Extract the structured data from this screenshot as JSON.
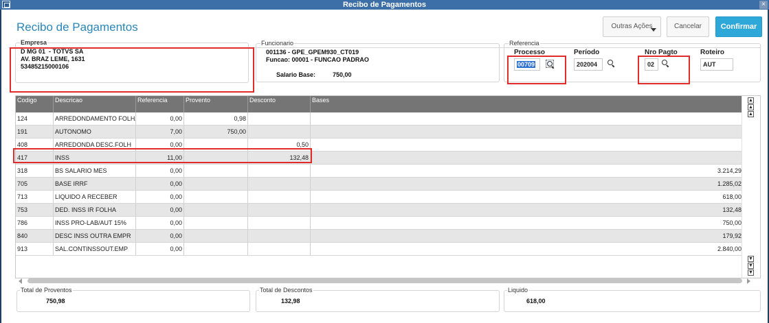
{
  "window": {
    "title": "Recibo de Pagamentos",
    "close_label": "×"
  },
  "header": {
    "page_title": "Recibo de Pagamentos",
    "outras_label": "Outras Ações",
    "cancelar_label": "Cancelar",
    "confirmar_label": "Confirmar"
  },
  "empresa": {
    "legend": "Empresa",
    "lines": [
      "D MG 01  - TOTVS SA",
      "AV. BRAZ LEME, 1631",
      "53485215000106"
    ]
  },
  "funcionario": {
    "legend": "Funcionario",
    "line1": "001136 - GPE_GPEM930_CT019",
    "line2": "Funcao: 00001 - FUNCAO PADRAO",
    "salario_label": "Salario Base:",
    "salario_value": "750,00"
  },
  "referencia": {
    "legend": "Referencia",
    "processo_label": "Processo",
    "processo_value": "00709",
    "periodo_label": "Período",
    "periodo_value": "202004",
    "nro_pagto_label": "Nro Pagto",
    "nro_pagto_value": "02",
    "roteiro_label": "Roteiro",
    "roteiro_value": "AUT"
  },
  "grid": {
    "columns": [
      "Codigo",
      "Descricao",
      "Referencia",
      "Provento",
      "Desconto",
      "Bases"
    ],
    "rows": [
      [
        "124",
        "ARREDONDAMENTO FOLHA",
        "0,00",
        "0,98",
        "",
        ""
      ],
      [
        "191",
        "AUTONOMO",
        "7,00",
        "750,00",
        "",
        ""
      ],
      [
        "408",
        "ARREDONDA DESC.FOLH",
        "0,00",
        "",
        "0,50",
        ""
      ],
      [
        "417",
        "INSS",
        "11,00",
        "",
        "132,48",
        ""
      ],
      [
        "318",
        "BS SALARIO MES",
        "0,00",
        "",
        "",
        "3.214,29"
      ],
      [
        "705",
        "BASE IRRF",
        "0,00",
        "",
        "",
        "1.285,02"
      ],
      [
        "713",
        "LIQUIDO A RECEBER",
        "0,00",
        "",
        "",
        "618,00"
      ],
      [
        "753",
        "DED. INSS IR FOLHA",
        "0,00",
        "",
        "",
        "132,48"
      ],
      [
        "786",
        "INSS PRO-LAB/AUT 15%",
        "0,00",
        "",
        "",
        "750,00"
      ],
      [
        "840",
        "DESC INSS OUTRA EMPR",
        "0,00",
        "",
        "",
        "179,92"
      ],
      [
        "913",
        "SAL.CONTINSSOUT.EMP",
        "0,00",
        "",
        "",
        "2.840,00"
      ]
    ]
  },
  "totals": {
    "proventos_label": "Total de Proventos",
    "proventos_value": "750,98",
    "descontos_label": "Total de Descontos",
    "descontos_value": "132,98",
    "liquido_label": "Liquido",
    "liquido_value": "618,00"
  },
  "colors": {
    "accent": "#2ea7d9",
    "titlebar": "#3c6fa8",
    "highlight": "#e12a2a",
    "grid_header": "#757575"
  }
}
